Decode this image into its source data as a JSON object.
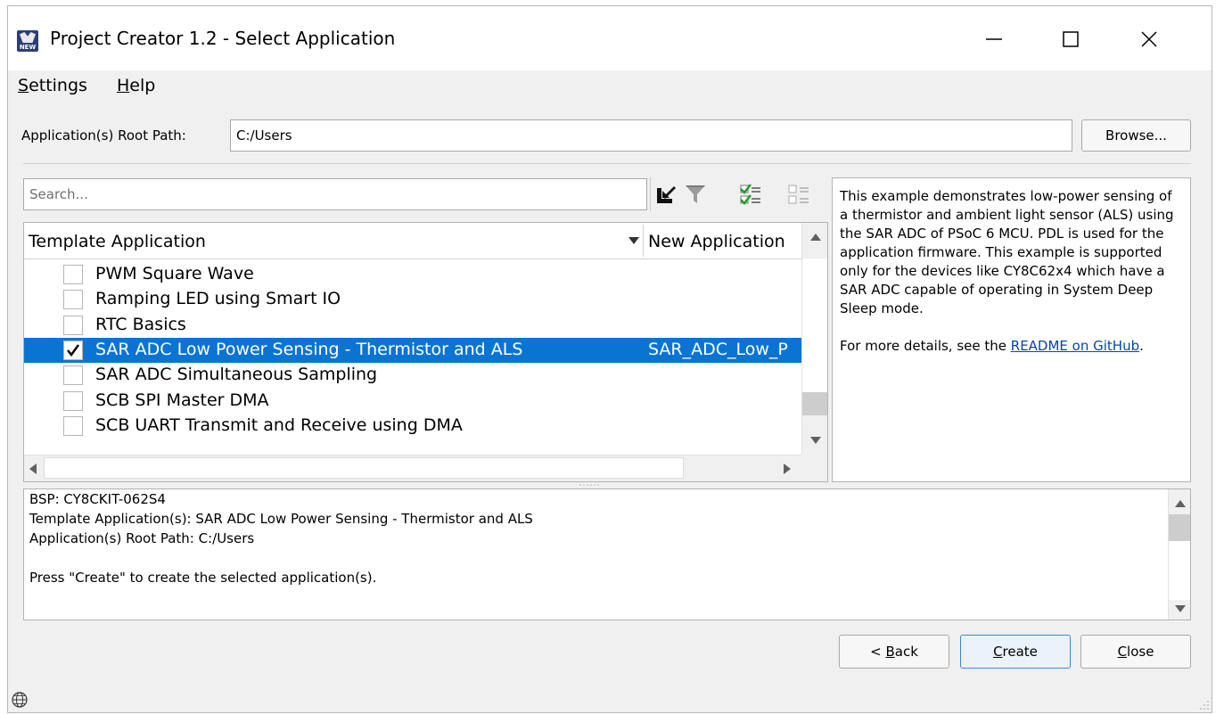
{
  "window": {
    "title": "Project Creator 1.2 - Select Application",
    "app_icon_text": "NEW",
    "controls": [
      "minimize-icon",
      "maximize-icon",
      "close-icon"
    ]
  },
  "menu": {
    "settings_prefix": "S",
    "settings_rest": "ettings",
    "help_prefix": "H",
    "help_rest": "elp"
  },
  "root_path": {
    "label": "Application(s) Root Path:",
    "value": "C:/Users",
    "browse_label": "Browse..."
  },
  "search": {
    "placeholder": "Search..."
  },
  "toolbar_icons": [
    "import-icon",
    "filter-icon",
    "select-all-icon",
    "deselect-all-icon"
  ],
  "table": {
    "columns": [
      "Template Application",
      "New Application"
    ],
    "rows": [
      {
        "name": "PWM Square Wave",
        "new_app": "",
        "checked": false,
        "selected": false
      },
      {
        "name": "Ramping LED using Smart IO",
        "new_app": "",
        "checked": false,
        "selected": false
      },
      {
        "name": "RTC Basics",
        "new_app": "",
        "checked": false,
        "selected": false
      },
      {
        "name": "SAR ADC Low Power Sensing - Thermistor and ALS",
        "new_app": "SAR_ADC_Low_P",
        "checked": true,
        "selected": true
      },
      {
        "name": "SAR ADC Simultaneous Sampling",
        "new_app": "",
        "checked": false,
        "selected": false
      },
      {
        "name": "SCB SPI Master DMA",
        "new_app": "",
        "checked": false,
        "selected": false
      },
      {
        "name": "SCB UART Transmit and Receive using DMA",
        "new_app": "",
        "checked": false,
        "selected": false
      }
    ]
  },
  "description": {
    "text": "This example demonstrates low-power sensing of a thermistor and ambient light sensor (ALS) using the SAR ADC of PSoC 6 MCU. PDL is used for the application firmware. This example is supported only for the devices like CY8C62x4 which have a SAR ADC capable of operating in System Deep Sleep mode.",
    "more_prefix": "For more details, see the ",
    "link_text": "README on GitHub",
    "more_suffix": "."
  },
  "summary": {
    "bsp": "BSP: CY8CKIT-062S4",
    "templates": "Template Application(s): SAR ADC Low Power Sensing - Thermistor and ALS",
    "root": "Application(s) Root Path: C:/Users",
    "instruction": "Press \"Create\" to create the selected application(s)."
  },
  "buttons": {
    "back_prefix": "< ",
    "back_key": "B",
    "back_rest": "ack",
    "create_key": "C",
    "create_rest": "reate",
    "close_key": "C",
    "close_rest": "lose"
  },
  "status_icon": "globe-icon"
}
